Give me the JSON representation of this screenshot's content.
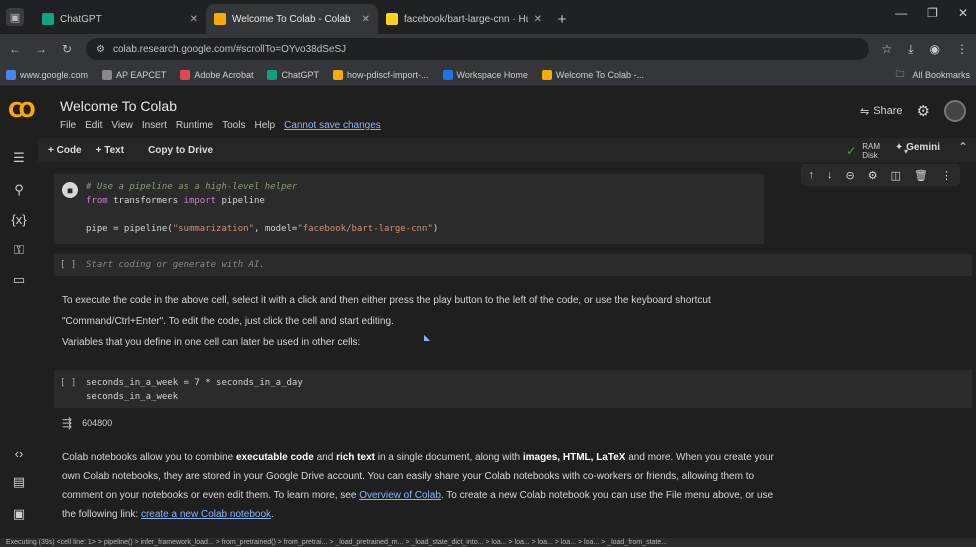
{
  "browser": {
    "tabs": [
      {
        "title": "ChatGPT",
        "color": "#10a37f",
        "active": false
      },
      {
        "title": "Welcome To Colab - Colab",
        "color": "#f9ab00",
        "active": true
      },
      {
        "title": "facebook/bart-large-cnn · Hug",
        "color": "#ffd21e",
        "active": false
      }
    ],
    "new_tab": "+",
    "url": "colab.research.google.com/#scrollTo=OYvo38dSeSJ",
    "bookmarks": [
      {
        "label": "www.google.com",
        "color": "#4285f4"
      },
      {
        "label": "AP EAPCET",
        "color": "#888888"
      },
      {
        "label": "Adobe Acrobat",
        "color": "#e34850"
      },
      {
        "label": "ChatGPT",
        "color": "#10a37f"
      },
      {
        "label": "how-pdiscf-import-...",
        "color": "#f9ab00"
      },
      {
        "label": "Workspace Home",
        "color": "#1a73e8"
      },
      {
        "label": "Welcome To Colab -...",
        "color": "#f9ab00"
      }
    ],
    "all_bookmarks": "All Bookmarks"
  },
  "colab": {
    "logo": "CO",
    "title": "Welcome To Colab",
    "menu": [
      "File",
      "Edit",
      "View",
      "Insert",
      "Runtime",
      "Tools",
      "Help"
    ],
    "unsaved": "Cannot save changes",
    "share": "Share",
    "toolbar": {
      "code": "+ Code",
      "text": "+ Text",
      "copy": "Copy to Drive"
    },
    "runtime": {
      "line1": "RAM",
      "line2": "Disk"
    },
    "gemini": "Gemini"
  },
  "cells": {
    "cell1": {
      "comment": "# Use a pipeline as a high-level helper",
      "import_from": "from",
      "import_mod": " transformers ",
      "import_kw": "import",
      "import_name": " pipeline",
      "line3_a": "pipe = pipeline(",
      "line3_s1": "\"summarization\"",
      "line3_b": ", model=",
      "line3_s2": "\"facebook/bart-large-cnn\"",
      "line3_c": ")"
    },
    "empty_cell": {
      "bracket": "[ ]",
      "placeholder": "Start coding or generate with AI."
    },
    "cell2": {
      "bracket": "[ ]",
      "line1": "seconds_in_a_week = 7 * seconds_in_a_day",
      "line2": "seconds_in_a_week",
      "output": "604800"
    }
  },
  "texts": {
    "p1": "To execute the code in the above cell, select it with a click and then either press the play button to the left of the code, or use the keyboard shortcut \"Command/Ctrl+Enter\". To edit the code, just click the cell and start editing.",
    "p2": "Variables that you define in one cell can later be used in other cells:",
    "p3_a": "Colab notebooks allow you to combine ",
    "p3_b1": "executable code",
    "p3_c": " and ",
    "p3_b2": "rich text",
    "p3_d": " in a single document, along with ",
    "p3_b3": "images, HTML, LaTeX",
    "p3_e": " and more. When you create your own Colab notebooks, they are stored in your Google Drive account. You can easily share your Colab notebooks with co-workers or friends, allowing them to comment on your notebooks or even edit them. To learn more, see ",
    "p3_link1": "Overview of Colab",
    "p3_f": ". To create a new Colab notebook you can use the File menu above, or use the following link: ",
    "p3_link2": "create a new Colab notebook",
    "p3_g": "."
  },
  "status": "Executing (39s) <cell line: 1> > pipeline() > infer_framework_load... > from_pretrained() > from_pretrai... > _load_pretrained_m... > _load_state_dict_into... > loa... > loa... > loa... > loa... > loa... > _load_from_state..."
}
